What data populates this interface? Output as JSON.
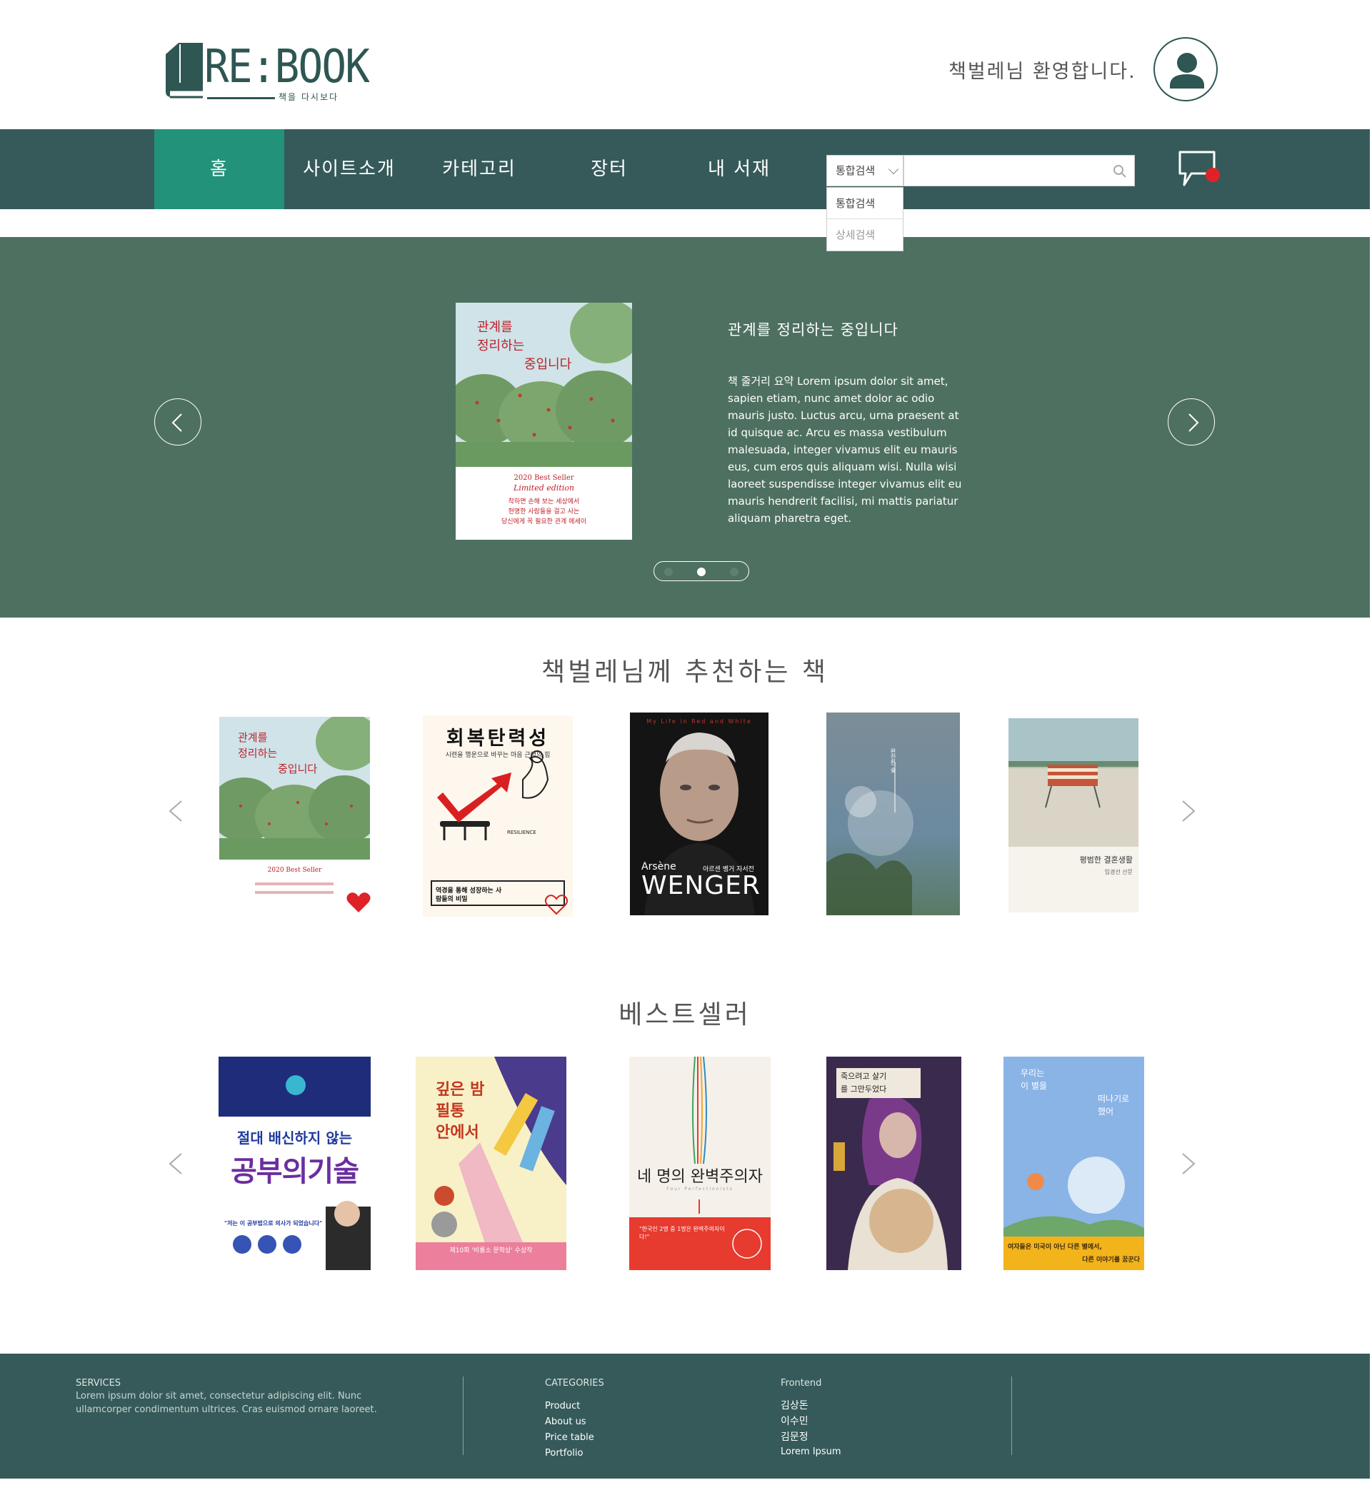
{
  "header": {
    "logo_text": "RE:BOOK",
    "logo_sub": "책을 다시보다",
    "welcome": "책벌레님 환영합니다."
  },
  "nav": {
    "items": [
      {
        "label": "홈"
      },
      {
        "label": "사이트소개"
      },
      {
        "label": "카테고리"
      },
      {
        "label": "장터"
      },
      {
        "label": "내 서재"
      }
    ],
    "search_select": "통합검색",
    "search_placeholder": "",
    "dropdown_options": [
      "통합검색",
      "상세검색"
    ]
  },
  "colors": {
    "nav_bg": "#355a59",
    "nav_active": "#23927a",
    "hero_bg": "#4e7061",
    "footer_bg": "#355a59",
    "notification": "#e02227"
  },
  "hero": {
    "book_title": "관계를 정리하는 중입니다",
    "description": "책 줄거리 요약 Lorem ipsum dolor sit amet, sapien etiam, nunc amet dolor ac odio mauris justo. Luctus arcu, urna praesent at id quisque ac. Arcu es massa vestibulum malesuada, integer vivamus elit eu mauris eus, cum eros quis aliquam wisi. Nulla wisi laoreet suspendisse integer vivamus elit eu mauris hendrerit facilisi, mi mattis pariatur aliquam pharetra eget.",
    "cover": {
      "title_lines": [
        "관계를",
        "정리하는",
        "중입니다"
      ],
      "badge": "2020 Best Seller",
      "edition": "Limited edition",
      "tagline_lines": [
        "착하면 손해 보는 세상에서",
        "현명한 사람들을 걸고 사는",
        "당신에게 꼭 필요한 관계 에세이"
      ]
    }
  },
  "recommend": {
    "title": "책벌레님께 추천하는 책",
    "books": [
      {
        "title_lines": [
          "관계를",
          "정리하는",
          "중입니다"
        ],
        "badge": "2020 Best Seller",
        "liked": true
      },
      {
        "title": "회복탄력성",
        "subtitle": "시련을 행운으로 바꾸는 마음 근력의 힘",
        "label": "RESILIENCE",
        "bottom": "역경을 통해 성장하는 사람들의 비밀",
        "liked": false
      },
      {
        "top": "My Life in Red and White",
        "first_name": "Arsène",
        "name": "WENGER",
        "korean": "아르센 벵거 자서전"
      },
      {
        "title": "완전한 숲"
      },
      {
        "title": "평범한 결혼생활",
        "author": "임경선 산문"
      }
    ]
  },
  "bestseller": {
    "title": "베스트셀러",
    "books": [
      {
        "title_lines": [
          "절대 배신하지 않는",
          "공부의기술"
        ],
        "quote": "\"저는 이 공부법으로 의사가 되었습니다\""
      },
      {
        "title_lines": [
          "깊은 밤",
          "필통",
          "안에서"
        ],
        "award": "제10회 '비룡소 문학상' 수상작"
      },
      {
        "title": "네 명의 완벽주의자",
        "subtitle": "Four Perfectionists",
        "quote": "\"한국인 2명 중 1명은 완벽주의자이다!\""
      },
      {
        "title_lines": [
          "죽으려고 살기",
          "를 그만두었다"
        ]
      },
      {
        "title_lines": [
          "우리는",
          "이 별을"
        ],
        "side_lines": [
          "떠나기로",
          "했어"
        ],
        "bottom_lines": [
          "여자들은 미국이 아닌 다른 별에서,",
          "다른 이야기를 꿈꾼다"
        ]
      }
    ]
  },
  "footer": {
    "services": {
      "heading": "SERVICES",
      "text": "Lorem ipsum dolor sit amet, consectetur adipiscing elit. Nunc ullamcorper condimentum ultrices. Cras euismod ornare laoreet."
    },
    "categories": {
      "heading": "CATEGORIES",
      "links": [
        "Product",
        "About us",
        "Price table",
        "Portfolio"
      ]
    },
    "frontend": {
      "heading": "Frontend",
      "links": [
        "김상돈",
        "이수민",
        "김문정",
        "Lorem Ipsum"
      ]
    }
  }
}
